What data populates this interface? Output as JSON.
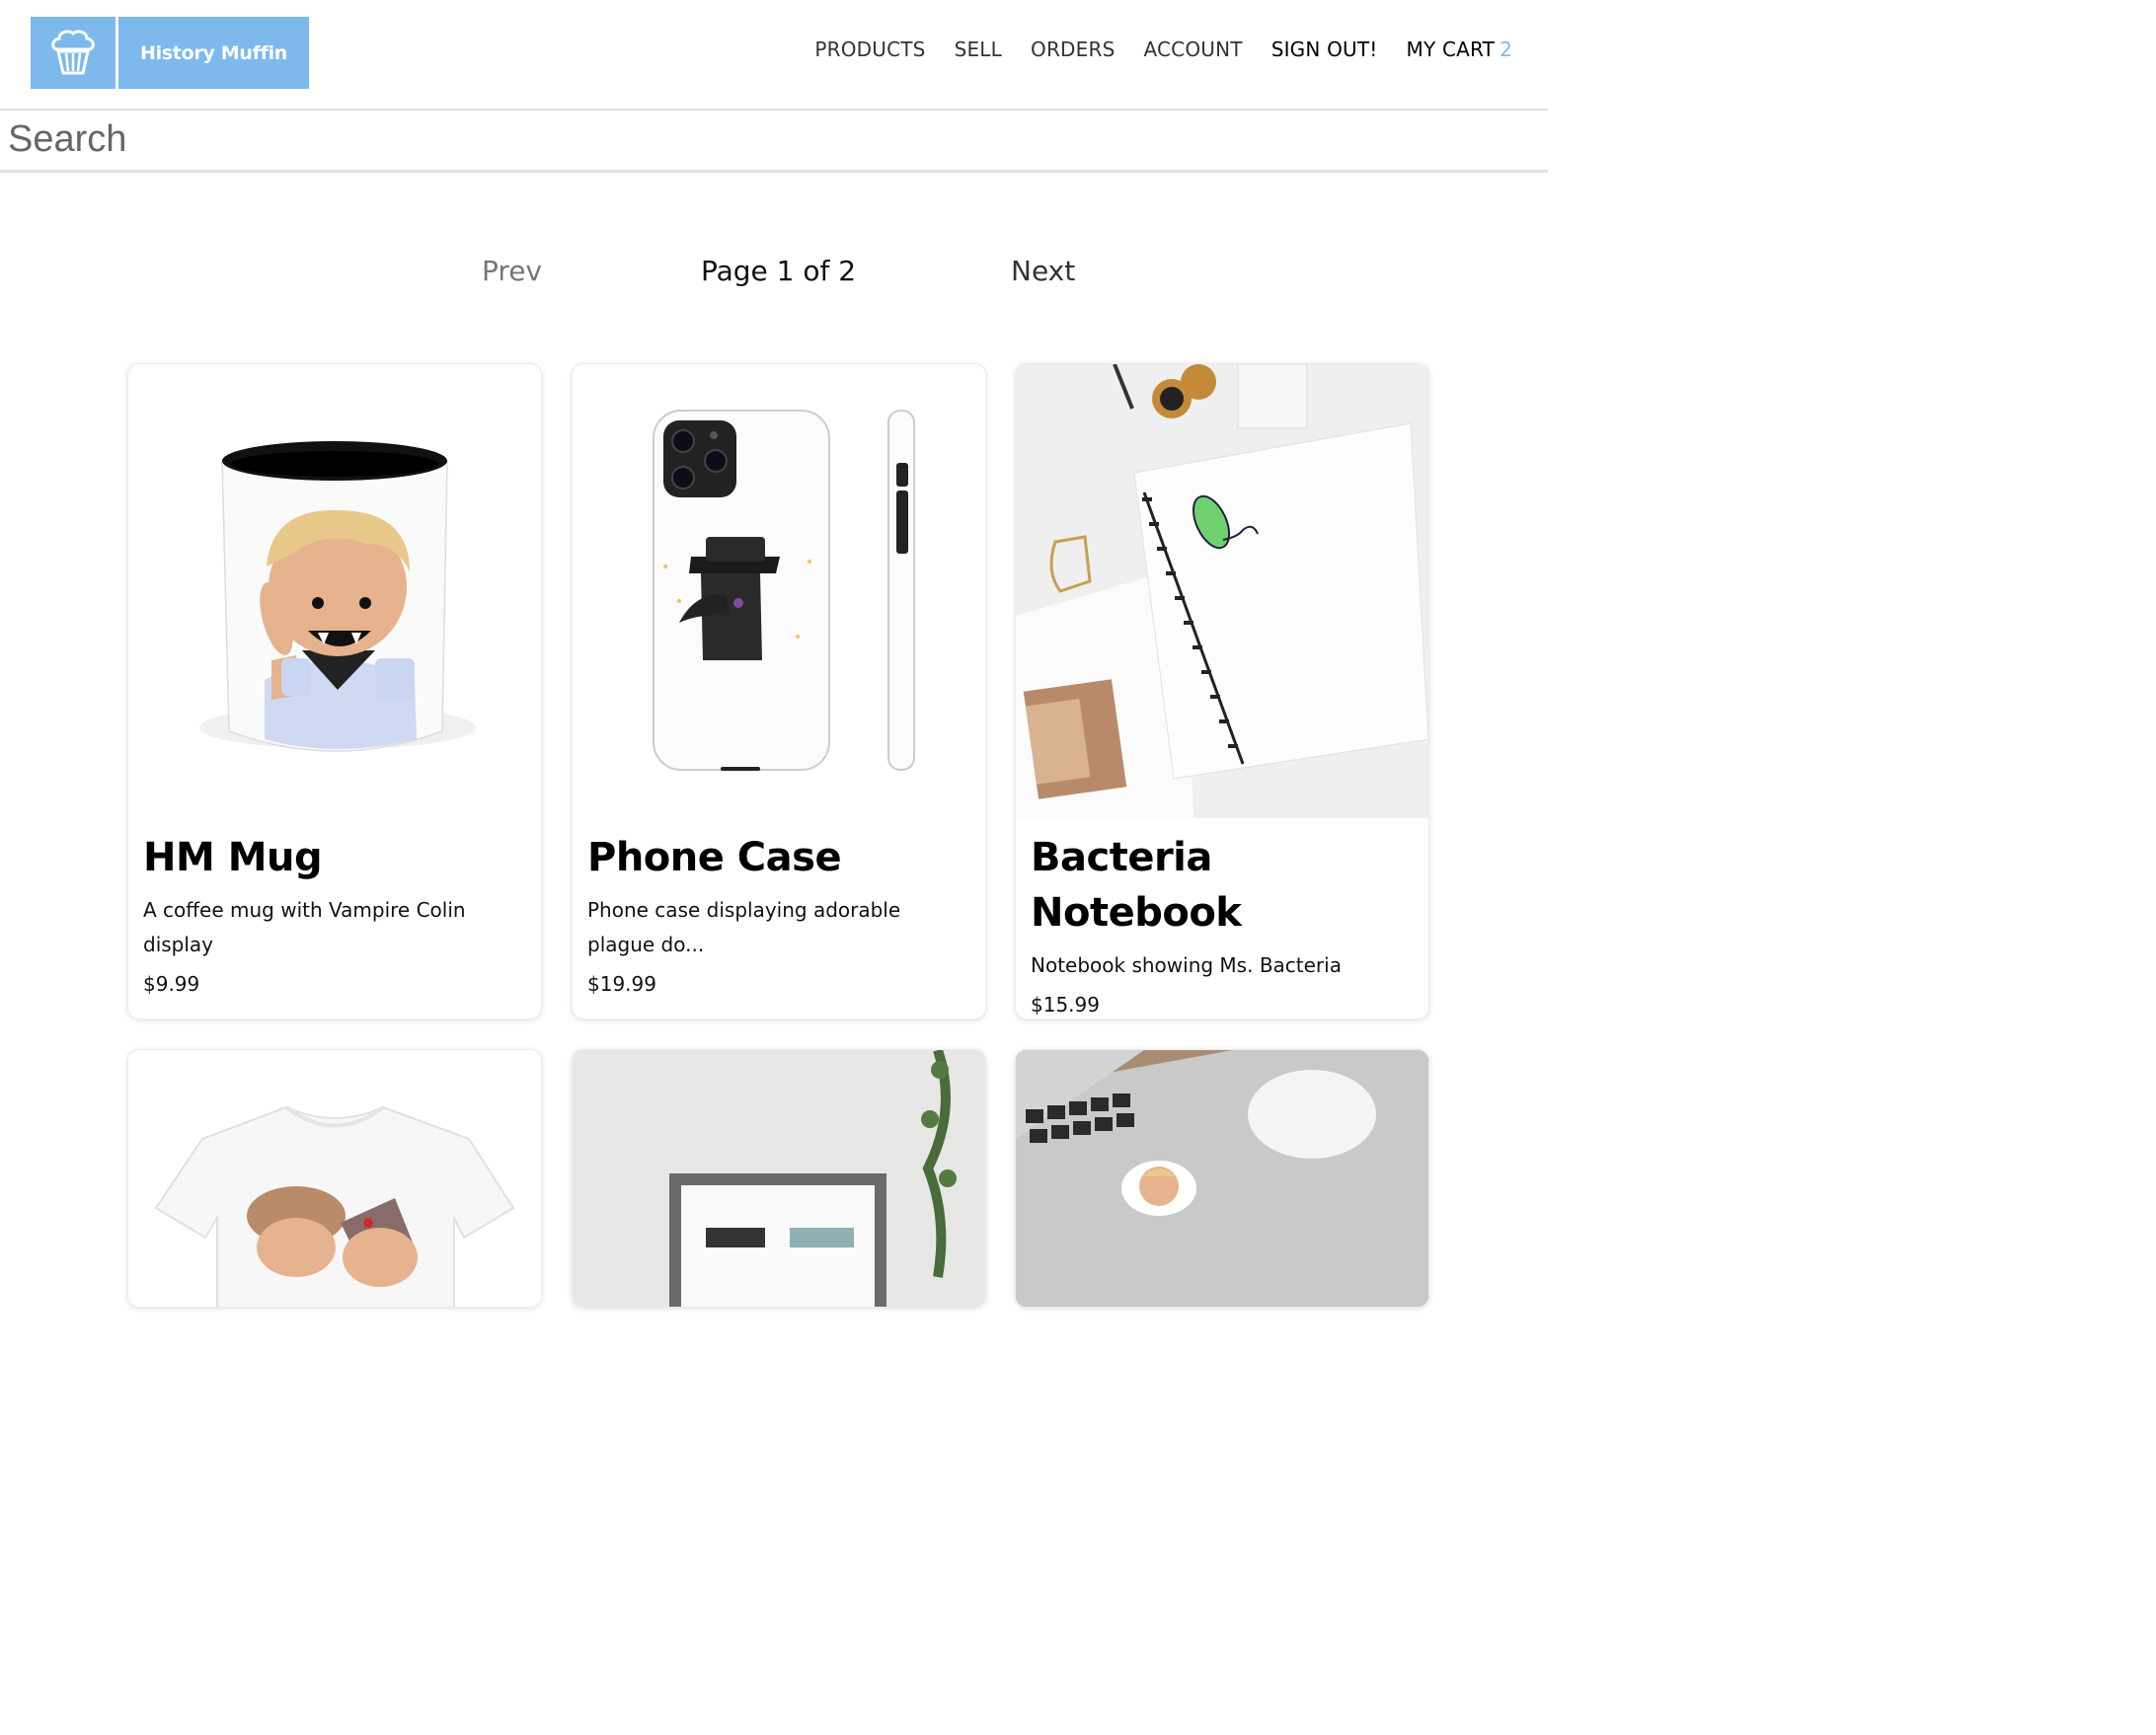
{
  "brand": {
    "name": "History Muffin",
    "icon": "muffin-icon",
    "color": "#7db9ec"
  },
  "nav": {
    "products": "PRODUCTS",
    "sell": "SELL",
    "orders": "ORDERS",
    "account": "ACCOUNT",
    "sign_out": "SIGN OUT!",
    "cart_label": "MY CART",
    "cart_count": "2"
  },
  "search": {
    "placeholder": "Search",
    "value": ""
  },
  "pagination": {
    "prev": "Prev",
    "page_info": "Page 1 of 2",
    "next": "Next"
  },
  "products": [
    {
      "title": "HM Mug",
      "description": "A coffee mug with Vampire Colin display",
      "price": "$9.99",
      "image": "vampire-mug"
    },
    {
      "title": "Phone Case",
      "description": "Phone case displaying adorable plague do...",
      "price": "$19.99",
      "image": "plague-doctor-phone-case"
    },
    {
      "title": "Bacteria Notebook",
      "description": "Notebook showing Ms. Bacteria",
      "price": "$15.99",
      "image": "bacteria-notebook"
    },
    {
      "image": "tshirt"
    },
    {
      "image": "framed-print"
    },
    {
      "image": "laptop-sticker"
    }
  ]
}
